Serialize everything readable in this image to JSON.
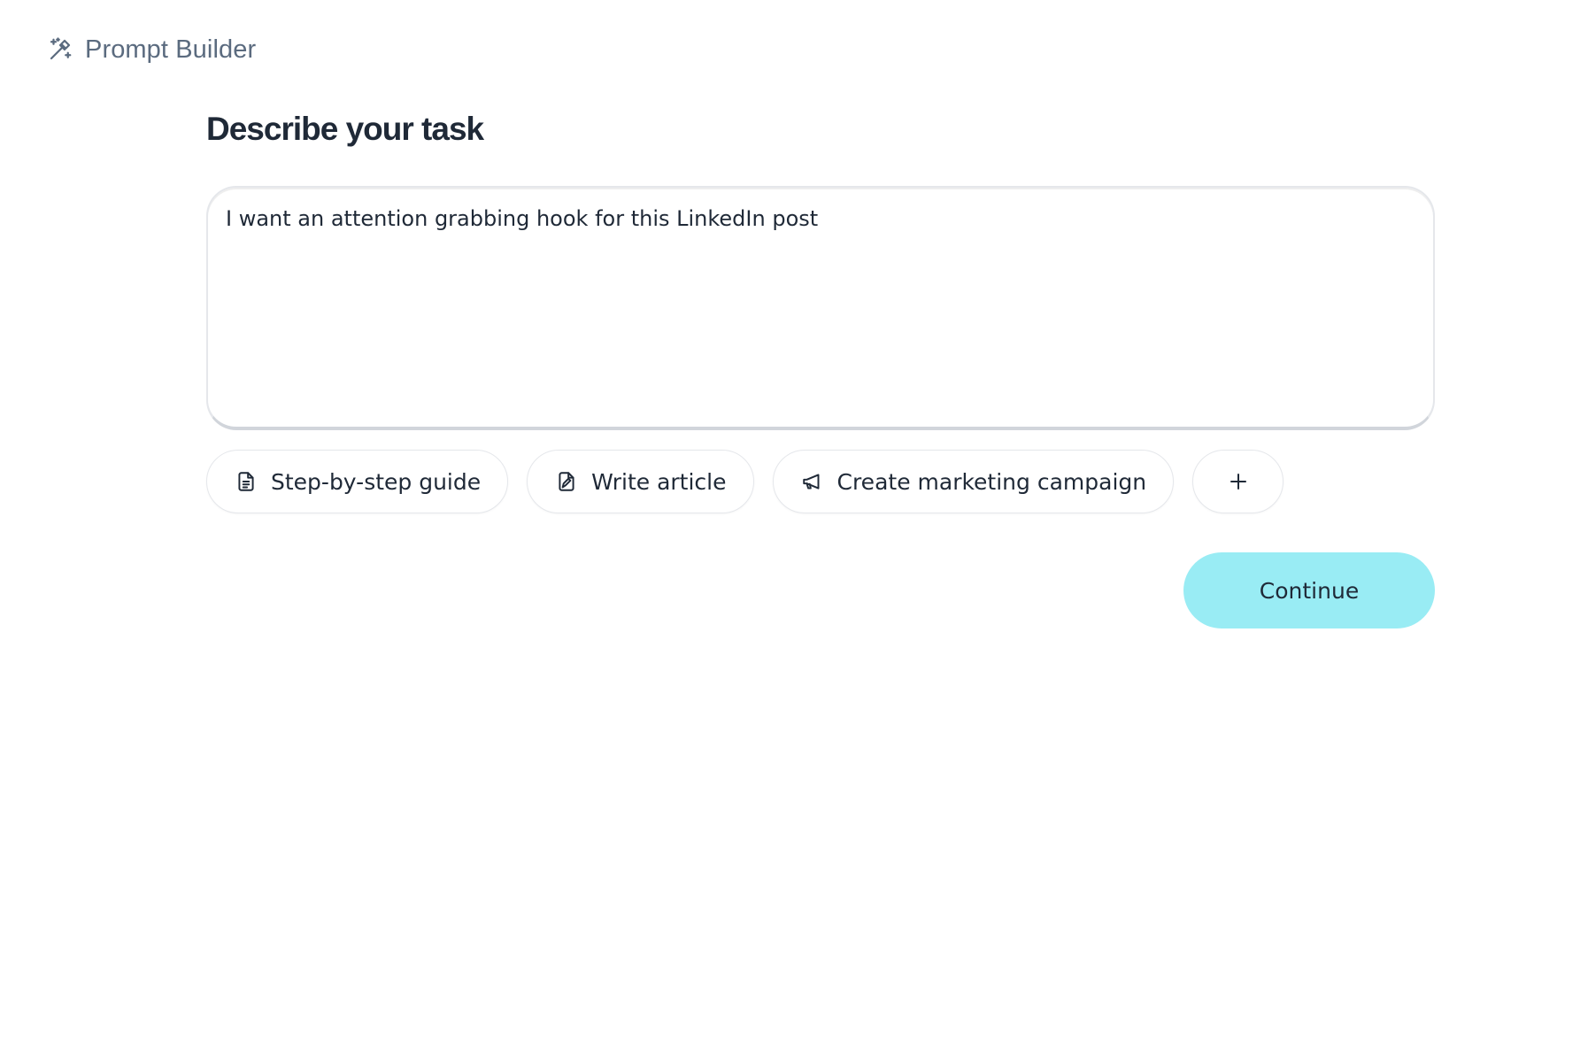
{
  "header": {
    "title": "Prompt Builder",
    "icon": "magic-wand-icon"
  },
  "main": {
    "title": "Describe your task",
    "task_input": {
      "value": "I want an attention grabbing hook for this LinkedIn post"
    },
    "suggestions": [
      {
        "label": "Step-by-step guide",
        "icon": "document-icon"
      },
      {
        "label": "Write article",
        "icon": "file-edit-icon"
      },
      {
        "label": "Create marketing campaign",
        "icon": "megaphone-icon"
      }
    ],
    "add_suggestion_icon": "plus-icon",
    "continue_label": "Continue"
  },
  "colors": {
    "accent": "#99ecf4",
    "text": "#1f2937",
    "muted": "#5b6b7f",
    "border": "#e5e7eb"
  }
}
